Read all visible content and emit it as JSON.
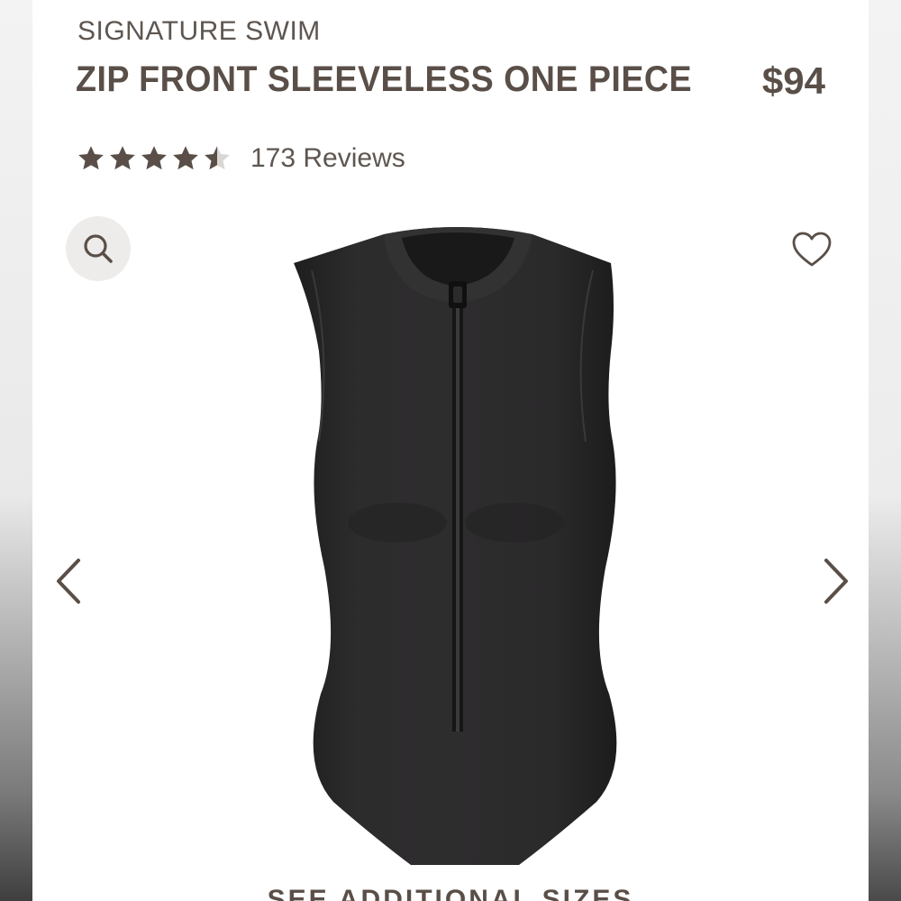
{
  "product": {
    "collection": "SIGNATURE SWIM",
    "title": "ZIP FRONT SLEEVELESS ONE PIECE",
    "price": "$94"
  },
  "rating": {
    "value_out_of_5": 4.5,
    "reviews_label": "173 Reviews"
  },
  "gallery": {
    "zoom_icon": "search-icon",
    "wishlist_icon": "heart-outline-icon",
    "prev_icon": "chevron-left-icon",
    "next_icon": "chevron-right-icon"
  },
  "footer": {
    "see_sizes_label": "SEE ADDITIONAL SIZES"
  },
  "colors": {
    "brand_text": "#5a4f48",
    "star_fill": "#5a4f48",
    "star_empty": "#d9d6d3",
    "zoom_bg": "#eeeceb",
    "swimsuit": "#2b2a2b"
  }
}
